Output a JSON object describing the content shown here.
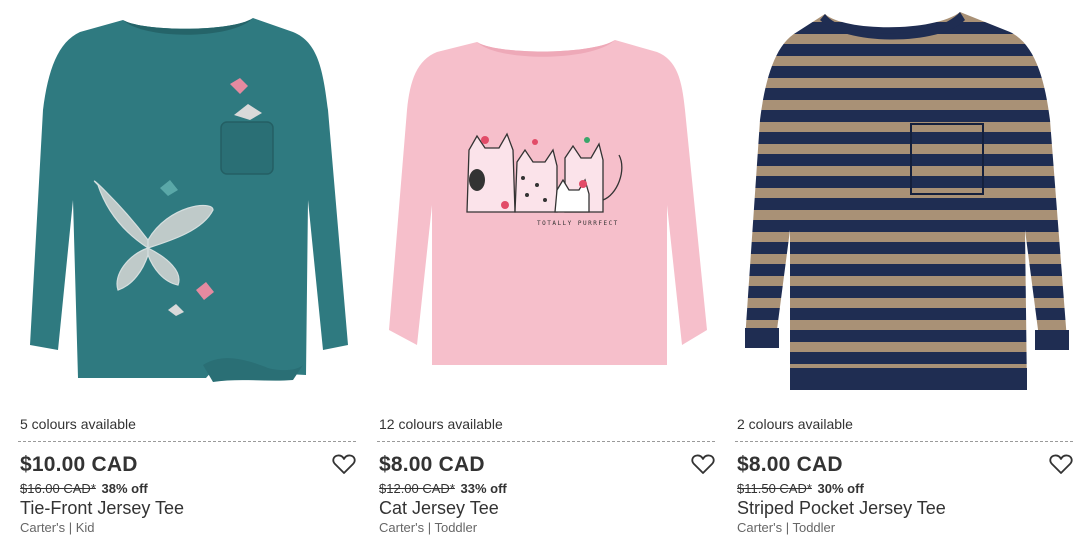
{
  "products": [
    {
      "colours": "5 colours available",
      "price": "$10.00 CAD",
      "original_price": "$16.00 CAD*",
      "discount": "38% off",
      "name": "Tie-Front Jersey Tee",
      "meta": "Carter's | Kid",
      "image": "teal long-sleeve tee with butterflies and pocket"
    },
    {
      "colours": "12 colours available",
      "price": "$8.00 CAD",
      "original_price": "$12.00 CAD*",
      "discount": "33% off",
      "name": "Cat Jersey Tee",
      "meta": "Carter's | Toddler",
      "image": "pink long-sleeve tee with cat family print"
    },
    {
      "colours": "2 colours available",
      "price": "$8.00 CAD",
      "original_price": "$11.50 CAD*",
      "discount": "30% off",
      "name": "Striped Pocket Jersey Tee",
      "meta": "Carter's | Toddler",
      "image": "navy and tan striped long-sleeve tee with pocket"
    }
  ],
  "print_text": "TOTALLY PURRFECT",
  "icons": {
    "wishlist": "heart-outline-icon"
  },
  "colors": {
    "teal": "#2f7a80",
    "pink": "#f6bfcb",
    "navy": "#1f2d52",
    "tan": "#a99176"
  }
}
